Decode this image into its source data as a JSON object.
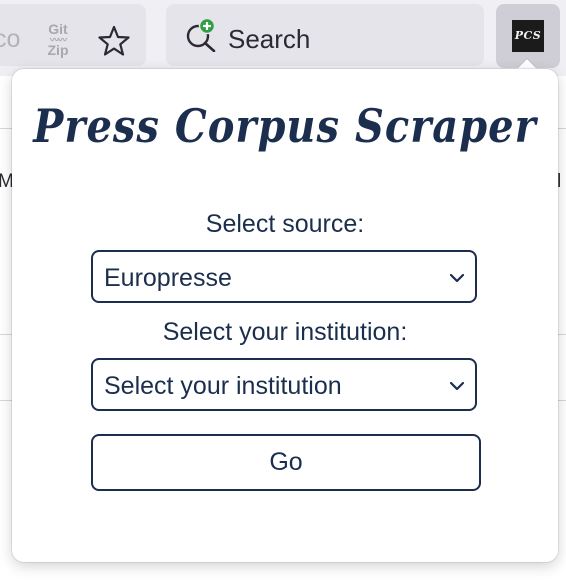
{
  "toolbar": {
    "url_fragment": "co",
    "gitzip": {
      "line1": "Git",
      "line2": "Zip"
    },
    "search_label": "Search",
    "extension_badge": "PCS"
  },
  "background": {
    "left_text": "Me",
    "right_text": "l"
  },
  "popup": {
    "title": "Press Corpus Scraper",
    "source_label": "Select source:",
    "source_value": "Europresse",
    "institution_label": "Select your institution:",
    "institution_value": "Select your institution",
    "go_label": "Go"
  },
  "colors": {
    "accent": "#1b2e4e",
    "toolbar_bg": "#f0eff4",
    "field_bg": "#e5e4ea",
    "add_green": "#2ea043"
  }
}
